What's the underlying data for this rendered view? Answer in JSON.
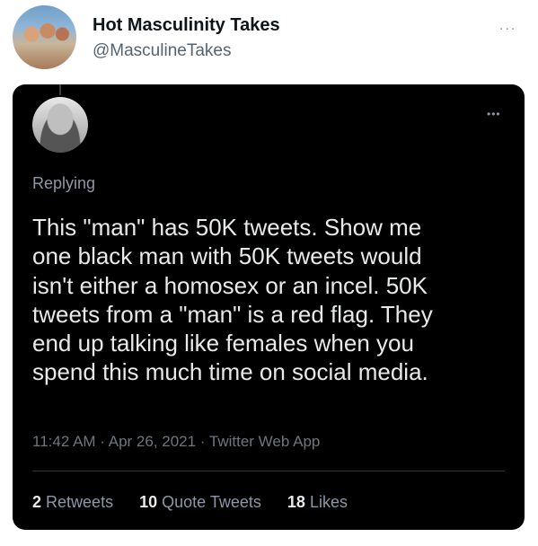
{
  "outer": {
    "name": "Hot Masculinity Takes",
    "handle": "@MasculineTakes",
    "more_icon": "..."
  },
  "tweet": {
    "more_icon": "•••",
    "replying": "Replying",
    "text": "This \"man\" has 50K tweets.  Show me\none black man with 50K tweets would\nisn't either a homosex or an incel.  50K\ntweets from a \"man\" is a red flag.  They\nend up talking like females when you\nspend this much time on social media.",
    "meta": "11:42 AM · Apr 26, 2021 · Twitter Web App",
    "stats": {
      "retweets_count": "2",
      "retweets_label": "Retweets",
      "quotes_count": "10",
      "quotes_label": "Quote Tweets",
      "likes_count": "18",
      "likes_label": "Likes"
    }
  }
}
